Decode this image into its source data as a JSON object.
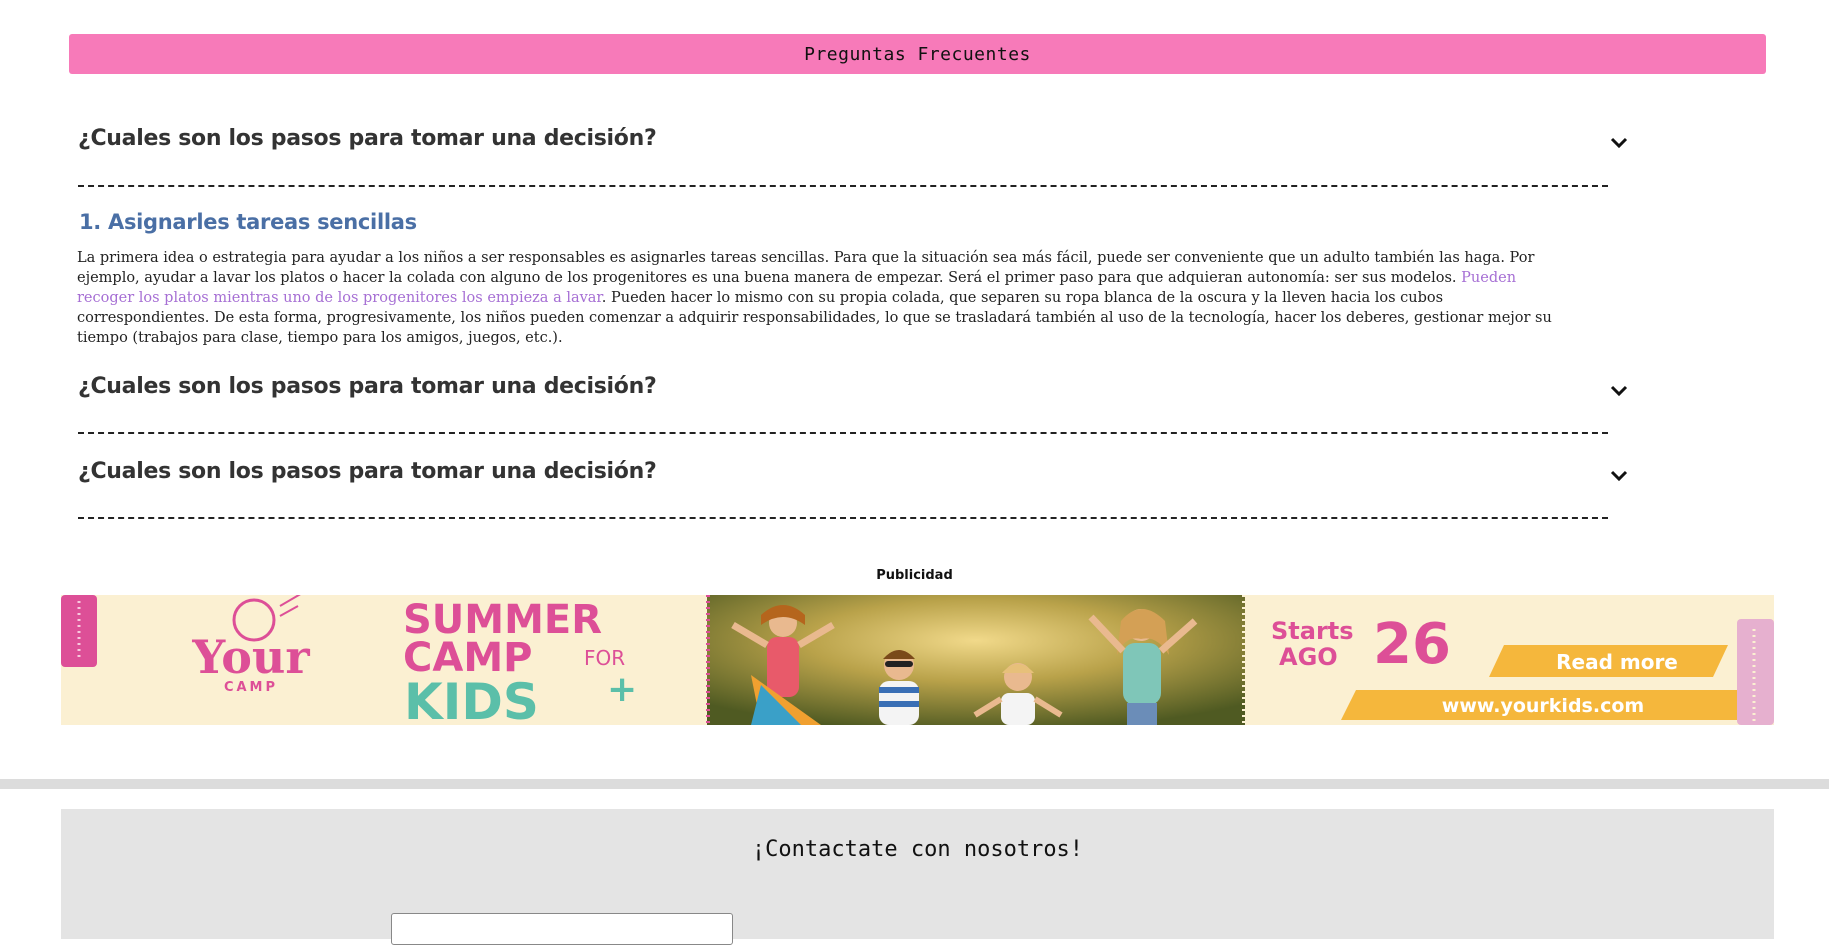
{
  "faq": {
    "header": "Preguntas Frecuentes",
    "items": [
      {
        "question": "¿Cuales son los pasos para tomar una decisión?",
        "icon": "chevron-down-icon"
      },
      {
        "question": "¿Cuales son los pasos para tomar una decisión?",
        "icon": "chevron-down-icon"
      },
      {
        "question": "¿Cuales son los pasos para tomar una decisión?",
        "icon": "chevron-down-icon"
      }
    ],
    "answer": {
      "title": "1. Asignarles tareas sencillas",
      "text_before": "La primera idea o estrategia para ayudar a los niños a ser responsables es asignarles tareas sencillas. Para que la situación sea más fácil, puede ser conveniente que un adulto también las haga. Por ejemplo, ayudar a lavar los platos o hacer la colada con alguno de los progenitores es una buena manera de empezar. Será el primer paso para que adquieran autonomía: ser sus modelos. ",
      "link_text": "Pueden recoger los platos mientras uno de los progenitores los empieza a lavar",
      "text_after": ". Pueden hacer lo mismo con su propia colada, que separen su ropa blanca de la oscura y la lleven hacia los cubos correspondientes. De esta forma, progresivamente, los niños pueden comenzar a adquirir responsabilidades, lo que se trasladará también al uso de la tecnología, hacer los deberes, gestionar mejor su tiempo (trabajos para clase, tiempo para los amigos, juegos, etc.)."
    }
  },
  "ad": {
    "label": "Publicidad",
    "brand_line1": "Your",
    "brand_line2": "CAMP",
    "headline1": "SUMMER",
    "headline2": "CAMP",
    "headline2_suffix": "FOR",
    "headline3": "KIDS",
    "plus": "+",
    "starts_label1": "Starts",
    "starts_label2": "AGO",
    "starts_day": "26",
    "cta": "Read more",
    "url": "www.yourkids.com"
  },
  "contact": {
    "title": "¡Contactate con nosotros!"
  },
  "colors": {
    "header_bg": "#f77ab9",
    "answer_title": "#4a6fa5",
    "link": "#a66fd4",
    "banner_bg": "#fbf0d2",
    "banner_pink": "#dd4f97",
    "banner_teal": "#5bbfa9",
    "banner_yellow": "#f5b73c"
  }
}
